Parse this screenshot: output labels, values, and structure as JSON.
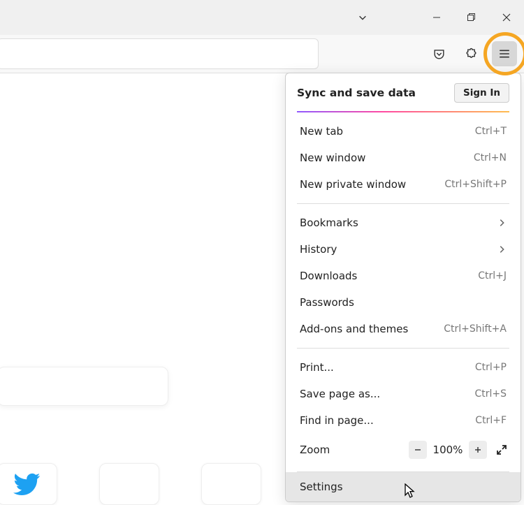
{
  "window": {
    "chevron_icon": "chevron-down"
  },
  "toolbar": {
    "pocket_icon": "pocket",
    "extensions_icon": "extensions",
    "hamburger_icon": "hamburger"
  },
  "menu": {
    "header": {
      "title": "Sync and save data",
      "signin_label": "Sign In"
    },
    "section1": [
      {
        "label": "New tab",
        "shortcut": "Ctrl+T"
      },
      {
        "label": "New window",
        "shortcut": "Ctrl+N"
      },
      {
        "label": "New private window",
        "shortcut": "Ctrl+Shift+P"
      }
    ],
    "section2": [
      {
        "label": "Bookmarks",
        "submenu": true
      },
      {
        "label": "History",
        "submenu": true
      },
      {
        "label": "Downloads",
        "shortcut": "Ctrl+J"
      },
      {
        "label": "Passwords"
      },
      {
        "label": "Add-ons and themes",
        "shortcut": "Ctrl+Shift+A"
      }
    ],
    "section3": [
      {
        "label": "Print...",
        "shortcut": "Ctrl+P"
      },
      {
        "label": "Save page as...",
        "shortcut": "Ctrl+S"
      },
      {
        "label": "Find in page...",
        "shortcut": "Ctrl+F"
      }
    ],
    "zoom": {
      "label": "Zoom",
      "value": "100%"
    },
    "section4": [
      {
        "label": "Settings",
        "selected": true
      }
    ]
  }
}
